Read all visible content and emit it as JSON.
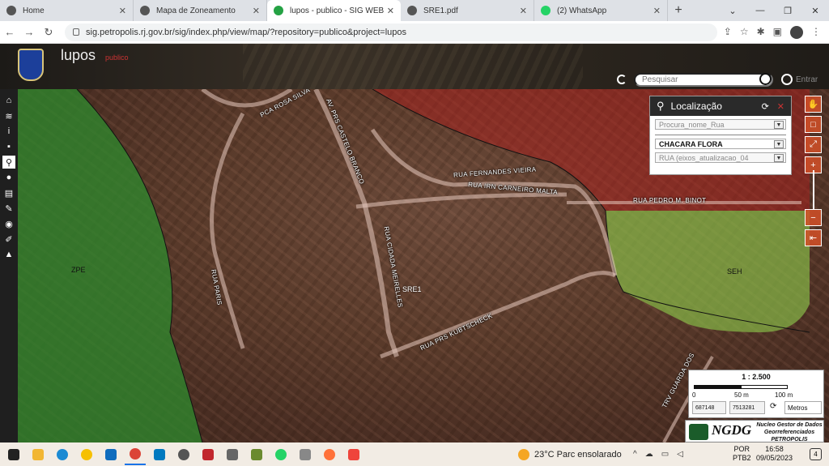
{
  "browser": {
    "tabs": [
      {
        "label": "Home"
      },
      {
        "label": "Mapa de Zoneamento"
      },
      {
        "label": "lupos - publico - SIG WEB Ph"
      },
      {
        "label": "SRE1.pdf"
      },
      {
        "label": "(2) WhatsApp"
      }
    ],
    "url": "sig.petropolis.rj.gov.br/sig/index.php/view/map/?repository=publico&project=lupos"
  },
  "app": {
    "title": "lupos",
    "subtitle": "publico",
    "search_placeholder": "Pesquisar",
    "login_label": "Entrar"
  },
  "localizacao": {
    "title": "Localização",
    "fields": [
      {
        "value": "Procura_nome_Rua"
      },
      {
        "value": "CHACARA FLORA"
      },
      {
        "value": "RUA (eixos_atualizacao_04"
      }
    ]
  },
  "map": {
    "streets": [
      "PCA ROSA SILVA",
      "AV. PRS CASTELO BRANCO",
      "RUA FERNANDES VIEIRA",
      "RUA IRN CARNEIRO MALTA",
      "RUA PEDRO M. BINOT",
      "RUA PARIS",
      "RUA CIDADA MEIRELLES",
      "RUA PRS KUBTSCHECK",
      "TRV GUARDA DOS"
    ],
    "zones": [
      "ZPE",
      "SRE1",
      "SEH"
    ],
    "colors": {
      "zpe": "#2e8b2e",
      "sre": "#b71c1c",
      "seh": "#8bc34a"
    }
  },
  "scale": {
    "ratio": "1 : 2.500",
    "ticks": [
      "0",
      "50 m",
      "100 m"
    ],
    "x": "687148",
    "y": "7513281",
    "unit": "Metros"
  },
  "logo": {
    "name": "NGDG",
    "line1": "Nucleo Gestor de Dados",
    "line2": "Georreferenciados",
    "line3": "PETROPOLIS"
  },
  "taskbar": {
    "weather": "23°C  Parc ensolarado",
    "lang1": "POR",
    "lang2": "PTB2",
    "time": "16:58",
    "date": "09/05/2023",
    "notifications": "4"
  }
}
